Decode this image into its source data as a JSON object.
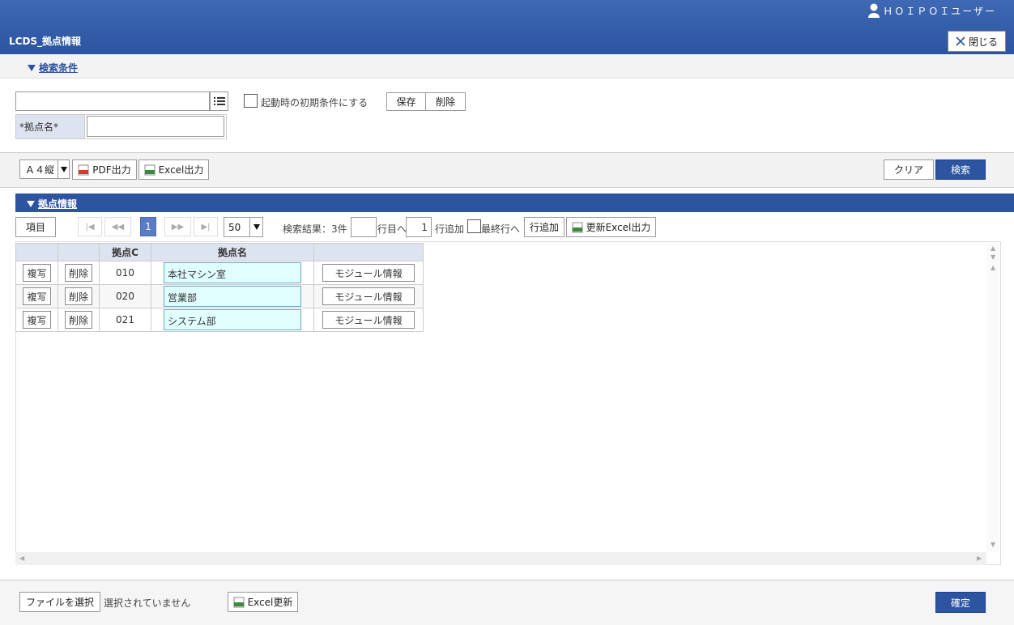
{
  "header": {
    "user_name": "ＨＯＩＰＯＩユーザー",
    "app_title": "LCDS_拠点情報",
    "close_label": "閉じる"
  },
  "search": {
    "section_title": "検索条件",
    "condition_value": "",
    "default_check_label": "起動時の初期条件にする",
    "save_label": "保存",
    "delete_label": "削除",
    "location_name_label": "*拠点名*",
    "location_name_value": ""
  },
  "toolbar": {
    "paper_size": "Ａ４縦",
    "pdf_label": "PDF出力",
    "excel_label": "Excel出力",
    "clear_label": "クリア",
    "search_label": "検索"
  },
  "group": {
    "title": "拠点情報",
    "items_label": "項目",
    "current_page": "1",
    "page_size": "50",
    "result_text": "検索結果：3件",
    "goto_row_value": "",
    "goto_row_suffix": "行目へ",
    "add_rows_value": "1",
    "add_rows_suffix": "行追加",
    "last_row_label": "最終行へ",
    "add_row_button": "行追加",
    "update_excel_button": "更新Excel出力"
  },
  "table": {
    "headers": [
      "",
      "",
      "拠点C",
      "拠点名",
      ""
    ],
    "copy_label": "複写",
    "delete_label": "削除",
    "module_label": "モジュール情報",
    "rows": [
      {
        "code": "010",
        "name": "本社マシン室"
      },
      {
        "code": "020",
        "name": "営業部"
      },
      {
        "code": "021",
        "name": "システム部"
      }
    ]
  },
  "footer": {
    "choose_file_label": "ファイルを選択",
    "no_file_text": "選択されていません",
    "excel_update_label": "Excel更新",
    "confirm_label": "確定"
  },
  "colors": {
    "header_blue": "#2c54a0",
    "label_bg": "#dde3ef",
    "name_input_bg": "#e1fefe"
  },
  "icons": [
    "user-icon",
    "close-icon",
    "list-icon",
    "pdf-icon",
    "excel-icon",
    "triangle-down-icon"
  ]
}
